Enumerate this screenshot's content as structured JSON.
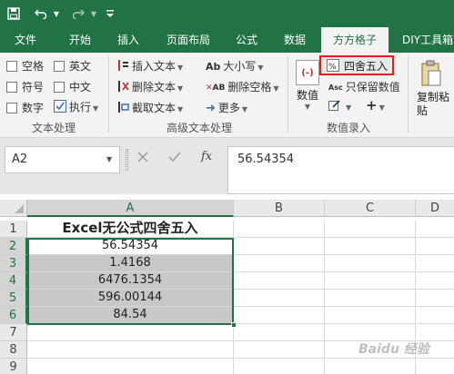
{
  "ribbon_tabs": [
    "文件",
    "开始",
    "插入",
    "页面布局",
    "公式",
    "数据",
    "方方格子",
    "DIY工具箱"
  ],
  "active_tab": "方方格子",
  "text_processing": {
    "checkboxes": [
      "空格",
      "英文",
      "符号",
      "中文",
      "数字"
    ],
    "execute_label": "执行",
    "group_label": "文本处理"
  },
  "advanced_text": {
    "insert_text": "插入文本",
    "delete_text": "删除文本",
    "extract_text": "截取文本",
    "case_label": "大小写",
    "delete_spaces": "删除空格",
    "more_label": "更多",
    "group_label": "高级文本处理"
  },
  "numeric_entry": {
    "value_button": "数值",
    "round_button": "四舍五入",
    "keep_value_button": "只保留数值",
    "group_label": "数值录入"
  },
  "copy_paste_label": "复制粘贴",
  "formula_bar": {
    "name_box": "A2",
    "fx_label": "fx",
    "formula_value": "56.54354"
  },
  "sheet": {
    "columns": [
      "A",
      "B",
      "C",
      "D"
    ],
    "rows": [
      "1",
      "2",
      "3",
      "4",
      "5",
      "6",
      "7",
      "8",
      "9"
    ],
    "title_cell": "Excel无公式四舍五入",
    "values": [
      "56.54354",
      "1.4168",
      "6476.1354",
      "596.00144",
      "84.54"
    ]
  },
  "watermark": "Baidu 经验",
  "colors": {
    "excel_green": "#217346",
    "highlight_red": "#e02020",
    "selection_shade": "#c8c8c8"
  }
}
